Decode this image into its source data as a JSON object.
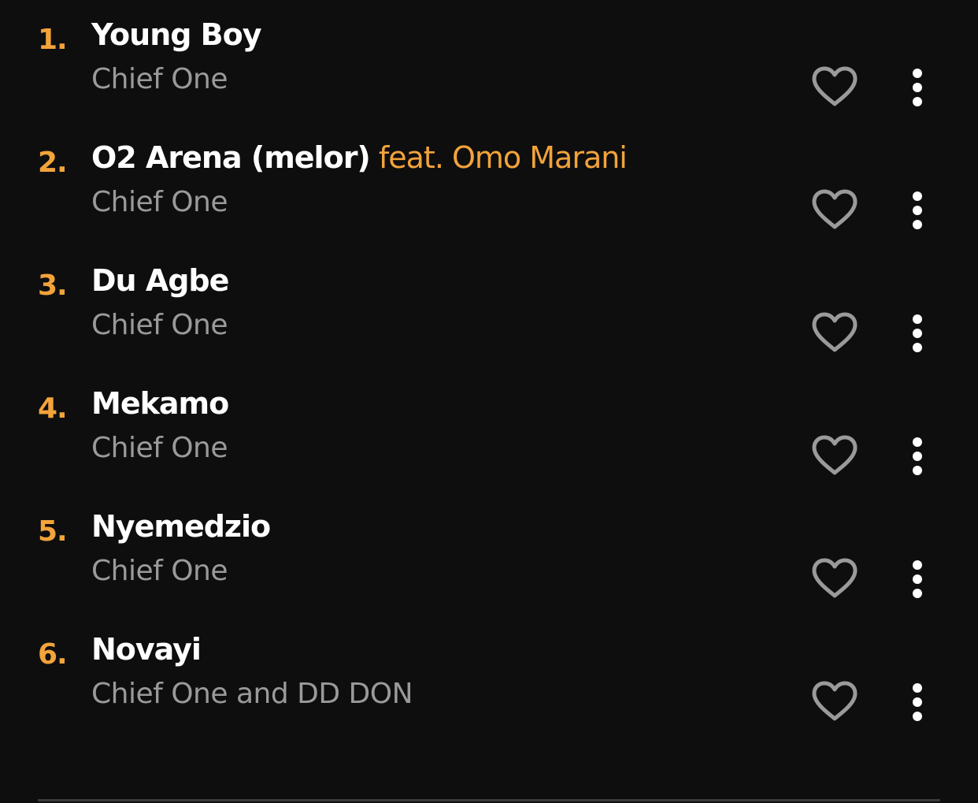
{
  "colors": {
    "background": "#0e0e0f",
    "accent": "#f2a33a",
    "title": "#ffffff",
    "artist": "#9a9a9a",
    "icon": "#9a9a9a",
    "more_icon": "#ffffff"
  },
  "icons": {
    "favorite": "heart-outline-icon",
    "more": "vertical-dots-icon"
  },
  "tracks": [
    {
      "number": "1.",
      "title": "Young Boy",
      "feat": "",
      "artist": "Chief One"
    },
    {
      "number": "2.",
      "title": "O2 Arena (melor)",
      "feat": "feat. Omo Marani",
      "artist": "Chief One"
    },
    {
      "number": "3.",
      "title": "Du Agbe",
      "feat": "",
      "artist": "Chief One"
    },
    {
      "number": "4.",
      "title": "Mekamo",
      "feat": "",
      "artist": "Chief One"
    },
    {
      "number": "5.",
      "title": "Nyemedzio",
      "feat": "",
      "artist": "Chief One"
    },
    {
      "number": "6.",
      "title": "Novayi",
      "feat": "",
      "artist": "Chief One and DD DON"
    }
  ]
}
